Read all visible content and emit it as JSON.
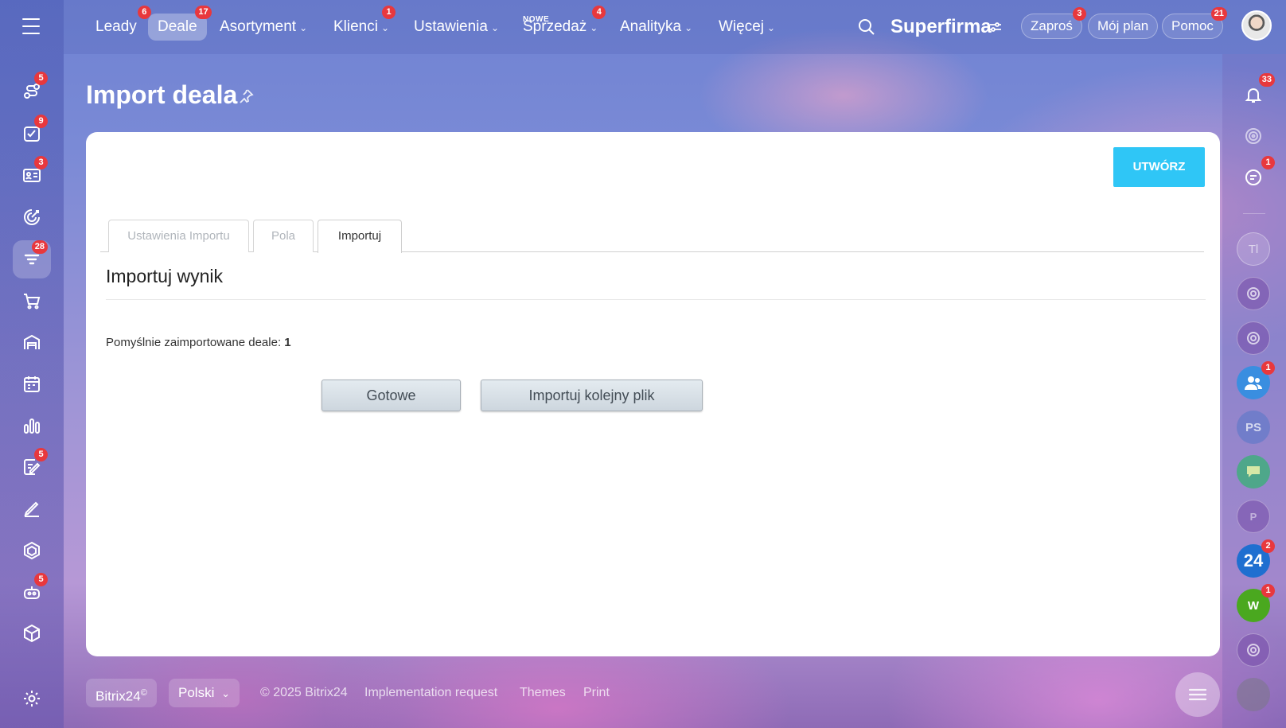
{
  "topbar": {
    "nav": [
      {
        "label": "Leady",
        "badge": "6",
        "active": false,
        "chevron": false
      },
      {
        "label": "Deale",
        "badge": "17",
        "active": true,
        "chevron": false
      },
      {
        "label": "Asortyment",
        "badge": "",
        "active": false,
        "chevron": true
      },
      {
        "label": "Klienci",
        "badge": "1",
        "active": false,
        "chevron": true
      },
      {
        "label": "Ustawienia",
        "badge": "",
        "active": false,
        "chevron": true
      },
      {
        "label": "Sprzedaż",
        "badge": "4",
        "active": false,
        "chevron": true,
        "tag": "NOWE"
      },
      {
        "label": "Analityka",
        "badge": "",
        "active": false,
        "chevron": true
      },
      {
        "label": "Więcej",
        "badge": "",
        "active": false,
        "chevron": true
      }
    ],
    "brand": "Superfirma",
    "invite": {
      "label": "Zaproś",
      "badge": "3"
    },
    "plan": {
      "label": "Mój plan"
    },
    "help": {
      "label": "Pomoc",
      "badge": "21"
    }
  },
  "left_rail": [
    {
      "icon": "funnel-icon",
      "badge": "5"
    },
    {
      "icon": "tasks-icon",
      "badge": "9"
    },
    {
      "icon": "contact-card-icon",
      "badge": "3"
    },
    {
      "icon": "target-icon",
      "badge": ""
    },
    {
      "icon": "crm-icon",
      "badge": "28",
      "active": true
    },
    {
      "icon": "cart-icon",
      "badge": ""
    },
    {
      "icon": "warehouse-icon",
      "badge": ""
    },
    {
      "icon": "calendar-icon",
      "badge": ""
    },
    {
      "icon": "analytics-icon",
      "badge": ""
    },
    {
      "icon": "signature-icon",
      "badge": "5"
    },
    {
      "icon": "pen-icon",
      "badge": ""
    },
    {
      "icon": "hexagon-icon",
      "badge": ""
    },
    {
      "icon": "bot-icon",
      "badge": "5"
    },
    {
      "icon": "box-icon",
      "badge": ""
    }
  ],
  "page": {
    "title": "Import deala",
    "create_label": "UTWÓRZ",
    "tabs": [
      "Ustawienia Importu",
      "Pola",
      "Importuj"
    ],
    "section_title": "Importuj wynik",
    "result_label": "Pomyślnie zaimportowane deale:",
    "result_count": "1",
    "done_label": "Gotowe",
    "import_another_label": "Importuj kolejny plik"
  },
  "right_rail": {
    "notifications_badge": "33",
    "chat_badge": "1",
    "tl": "Tl",
    "group_badge": "1",
    "ps": "PS",
    "p": "P",
    "b24": "24",
    "b24_badge": "2",
    "w": "W",
    "w_badge": "1"
  },
  "footer": {
    "brand": "Bitrix24",
    "brand_mark": "©",
    "language": "Polski",
    "copyright": "© 2025 Bitrix24",
    "impl": "Implementation request",
    "themes": "Themes",
    "print": "Print"
  },
  "colors": {
    "accent": "#2fc6f6",
    "badge": "#e8383d",
    "b24": "#1f6fd0",
    "w": "#4aa81f"
  }
}
